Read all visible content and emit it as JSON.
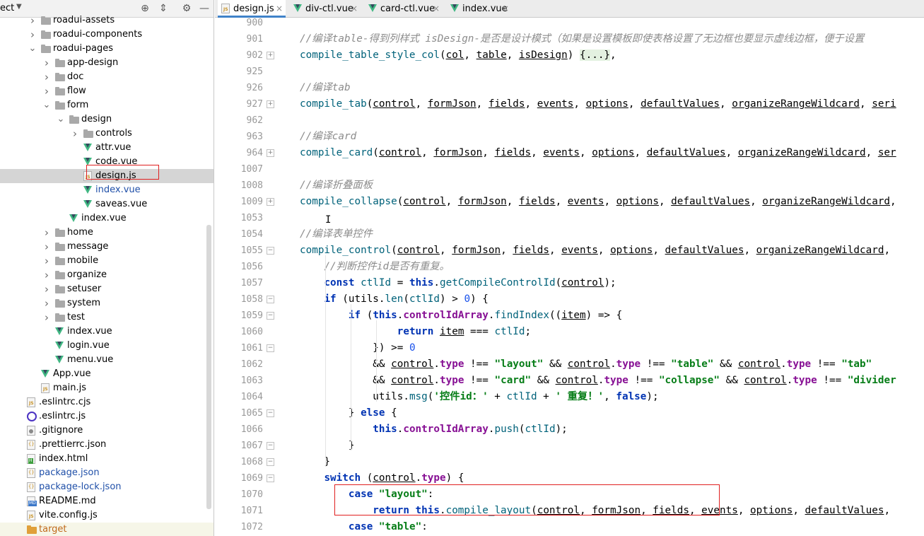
{
  "project_panel": {
    "title": "ect",
    "tree": [
      {
        "label": "roadui-assets",
        "kind": "folder",
        "depth": 1,
        "expanded": false
      },
      {
        "label": "roadui-components",
        "kind": "folder",
        "depth": 1,
        "expanded": false
      },
      {
        "label": "roadui-pages",
        "kind": "folder",
        "depth": 1,
        "expanded": true
      },
      {
        "label": "app-design",
        "kind": "folder",
        "depth": 2,
        "expanded": false
      },
      {
        "label": "doc",
        "kind": "folder",
        "depth": 2,
        "expanded": false
      },
      {
        "label": "flow",
        "kind": "folder",
        "depth": 2,
        "expanded": false
      },
      {
        "label": "form",
        "kind": "folder",
        "depth": 2,
        "expanded": true
      },
      {
        "label": "design",
        "kind": "folder",
        "depth": 3,
        "expanded": true
      },
      {
        "label": "controls",
        "kind": "folder",
        "depth": 4,
        "expanded": false
      },
      {
        "label": "attr.vue",
        "kind": "vue",
        "depth": 4
      },
      {
        "label": "code.vue",
        "kind": "vue",
        "depth": 4
      },
      {
        "label": "design.js",
        "kind": "js",
        "depth": 4,
        "selected": true
      },
      {
        "label": "index.vue",
        "kind": "vue",
        "depth": 4,
        "blue": true
      },
      {
        "label": "saveas.vue",
        "kind": "vue",
        "depth": 4
      },
      {
        "label": "index.vue",
        "kind": "vue",
        "depth": 3
      },
      {
        "label": "home",
        "kind": "folder",
        "depth": 2,
        "expanded": false
      },
      {
        "label": "message",
        "kind": "folder",
        "depth": 2,
        "expanded": false
      },
      {
        "label": "mobile",
        "kind": "folder",
        "depth": 2,
        "expanded": false
      },
      {
        "label": "organize",
        "kind": "folder",
        "depth": 2,
        "expanded": false
      },
      {
        "label": "setuser",
        "kind": "folder",
        "depth": 2,
        "expanded": false
      },
      {
        "label": "system",
        "kind": "folder",
        "depth": 2,
        "expanded": false
      },
      {
        "label": "test",
        "kind": "folder",
        "depth": 2,
        "expanded": false
      },
      {
        "label": "index.vue",
        "kind": "vue",
        "depth": 2
      },
      {
        "label": "login.vue",
        "kind": "vue",
        "depth": 2
      },
      {
        "label": "menu.vue",
        "kind": "vue",
        "depth": 2
      },
      {
        "label": "App.vue",
        "kind": "vue",
        "depth": 1
      },
      {
        "label": "main.js",
        "kind": "js",
        "depth": 1
      },
      {
        "label": ".eslintrc.cjs",
        "kind": "js",
        "depth": 0
      },
      {
        "label": ".eslintrc.js",
        "kind": "eslint",
        "depth": 0
      },
      {
        "label": ".gitignore",
        "kind": "git",
        "depth": 0
      },
      {
        "label": ".prettierrc.json",
        "kind": "json",
        "depth": 0
      },
      {
        "label": "index.html",
        "kind": "html",
        "depth": 0
      },
      {
        "label": "package.json",
        "kind": "json",
        "depth": 0,
        "blue": true
      },
      {
        "label": "package-lock.json",
        "kind": "json",
        "depth": 0,
        "blue": true
      },
      {
        "label": "README.md",
        "kind": "md",
        "depth": 0
      },
      {
        "label": "vite.config.js",
        "kind": "js",
        "depth": 0
      },
      {
        "label": "target",
        "kind": "folder-orange",
        "depth": 0,
        "orange": true
      }
    ]
  },
  "tabs": [
    {
      "label": "design.js",
      "kind": "js",
      "active": true
    },
    {
      "label": "div-ctl.vue",
      "kind": "vue"
    },
    {
      "label": "card-ctl.vue",
      "kind": "vue"
    },
    {
      "label": "index.vue",
      "kind": "vue"
    }
  ],
  "tab_close_glyph": "×",
  "line_numbers": [
    "900",
    "901",
    "902",
    "925",
    "926",
    "927",
    "962",
    "963",
    "964",
    "1007",
    "1008",
    "1009",
    "1053",
    "1054",
    "1055",
    "1056",
    "1057",
    "1058",
    "1059",
    "1060",
    "1061",
    "1062",
    "1063",
    "1064",
    "1065",
    "1066",
    "1067",
    "1068",
    "1069",
    "1070",
    "1071",
    "1072"
  ],
  "code_lines": [
    [],
    [
      [
        "cm",
        "//编译table-得到列样式 isDesign-是否是设计模式（如果是设置模板即使表格设置了无边框也要显示虚线边框，便于设置"
      ]
    ],
    [
      [
        "fn",
        "compile_table_style_col"
      ],
      [
        "t",
        "("
      ],
      [
        "prm",
        "col"
      ],
      [
        "t",
        ", "
      ],
      [
        "prm",
        "table"
      ],
      [
        "t",
        ", "
      ],
      [
        "prm",
        "isDesign"
      ],
      [
        "t",
        ") "
      ],
      [
        "fld",
        "{...}"
      ],
      [
        "t",
        ","
      ]
    ],
    [],
    [
      [
        "cm",
        "//编译tab"
      ]
    ],
    [
      [
        "fn",
        "compile_tab"
      ],
      [
        "t",
        "("
      ],
      [
        "prm",
        "control"
      ],
      [
        "t",
        ", "
      ],
      [
        "prm",
        "formJson"
      ],
      [
        "t",
        ", "
      ],
      [
        "prm",
        "fields"
      ],
      [
        "t",
        ", "
      ],
      [
        "prm",
        "events"
      ],
      [
        "t",
        ", "
      ],
      [
        "prm",
        "options"
      ],
      [
        "t",
        ", "
      ],
      [
        "prm",
        "defaultValues"
      ],
      [
        "t",
        ", "
      ],
      [
        "prm",
        "organizeRangeWildcard"
      ],
      [
        "t",
        ", "
      ],
      [
        "prm",
        "seri"
      ]
    ],
    [],
    [
      [
        "cm",
        "//编译card"
      ]
    ],
    [
      [
        "fn",
        "compile_card"
      ],
      [
        "t",
        "("
      ],
      [
        "prm",
        "control"
      ],
      [
        "t",
        ", "
      ],
      [
        "prm",
        "formJson"
      ],
      [
        "t",
        ", "
      ],
      [
        "prm",
        "fields"
      ],
      [
        "t",
        ", "
      ],
      [
        "prm",
        "events"
      ],
      [
        "t",
        ", "
      ],
      [
        "prm",
        "options"
      ],
      [
        "t",
        ", "
      ],
      [
        "prm",
        "defaultValues"
      ],
      [
        "t",
        ", "
      ],
      [
        "prm",
        "organizeRangeWildcard"
      ],
      [
        "t",
        ", "
      ],
      [
        "prm",
        "ser"
      ]
    ],
    [],
    [
      [
        "cm",
        "//编译折叠面板"
      ]
    ],
    [
      [
        "fn",
        "compile_collapse"
      ],
      [
        "t",
        "("
      ],
      [
        "prm",
        "control"
      ],
      [
        "t",
        ", "
      ],
      [
        "prm",
        "formJson"
      ],
      [
        "t",
        ", "
      ],
      [
        "prm",
        "fields"
      ],
      [
        "t",
        ", "
      ],
      [
        "prm",
        "events"
      ],
      [
        "t",
        ", "
      ],
      [
        "prm",
        "options"
      ],
      [
        "t",
        ", "
      ],
      [
        "prm",
        "defaultValues"
      ],
      [
        "t",
        ", "
      ],
      [
        "prm",
        "organizeRangeWildcard"
      ],
      [
        "t",
        ","
      ]
    ],
    [],
    [
      [
        "cm",
        "//编译表单控件"
      ]
    ],
    [
      [
        "fn",
        "compile_control"
      ],
      [
        "t",
        "("
      ],
      [
        "prm",
        "control"
      ],
      [
        "t",
        ", "
      ],
      [
        "prm",
        "formJson"
      ],
      [
        "t",
        ", "
      ],
      [
        "prm",
        "fields"
      ],
      [
        "t",
        ", "
      ],
      [
        "prm",
        "events"
      ],
      [
        "t",
        ", "
      ],
      [
        "prm",
        "options"
      ],
      [
        "t",
        ", "
      ],
      [
        "prm",
        "defaultValues"
      ],
      [
        "t",
        ", "
      ],
      [
        "prm",
        "organizeRangeWildcard"
      ],
      [
        "t",
        ", "
      ]
    ],
    [
      [
        "t",
        "    "
      ],
      [
        "cm",
        "//判断控件id是否有重复。"
      ]
    ],
    [
      [
        "t",
        "    "
      ],
      [
        "kw",
        "const "
      ],
      [
        "var",
        "ctlId"
      ],
      [
        "t",
        " = "
      ],
      [
        "kw",
        "this"
      ],
      [
        "t",
        "."
      ],
      [
        "mth",
        "getCompileControlId"
      ],
      [
        "t",
        "("
      ],
      [
        "prm",
        "control"
      ],
      [
        "t",
        ");"
      ]
    ],
    [
      [
        "t",
        "    "
      ],
      [
        "kw",
        "if "
      ],
      [
        "t",
        "(utils."
      ],
      [
        "mth",
        "len"
      ],
      [
        "t",
        "("
      ],
      [
        "var",
        "ctlId"
      ],
      [
        "t",
        ") > "
      ],
      [
        "num",
        "0"
      ],
      [
        "t",
        ") {"
      ]
    ],
    [
      [
        "t",
        "        "
      ],
      [
        "kw",
        "if "
      ],
      [
        "t",
        "("
      ],
      [
        "kw",
        "this"
      ],
      [
        "t",
        "."
      ],
      [
        "prop",
        "controlIdArray"
      ],
      [
        "t",
        "."
      ],
      [
        "mth",
        "findIndex"
      ],
      [
        "t",
        "(("
      ],
      [
        "prm",
        "item"
      ],
      [
        "t",
        ") => {"
      ]
    ],
    [
      [
        "t",
        "                "
      ],
      [
        "kw",
        "return "
      ],
      [
        "prm",
        "item"
      ],
      [
        "t",
        " === "
      ],
      [
        "var",
        "ctlId"
      ],
      [
        "t",
        ";"
      ]
    ],
    [
      [
        "t",
        "            }) >= "
      ],
      [
        "num",
        "0"
      ]
    ],
    [
      [
        "t",
        "            && "
      ],
      [
        "prm",
        "control"
      ],
      [
        "t",
        "."
      ],
      [
        "prop",
        "type"
      ],
      [
        "t",
        " !== "
      ],
      [
        "str",
        "\"layout\""
      ],
      [
        "t",
        " && "
      ],
      [
        "prm",
        "control"
      ],
      [
        "t",
        "."
      ],
      [
        "prop",
        "type"
      ],
      [
        "t",
        " !== "
      ],
      [
        "str",
        "\"table\""
      ],
      [
        "t",
        " && "
      ],
      [
        "prm",
        "control"
      ],
      [
        "t",
        "."
      ],
      [
        "prop",
        "type"
      ],
      [
        "t",
        " !== "
      ],
      [
        "str",
        "\"tab\""
      ]
    ],
    [
      [
        "t",
        "            && "
      ],
      [
        "prm",
        "control"
      ],
      [
        "t",
        "."
      ],
      [
        "prop",
        "type"
      ],
      [
        "t",
        " !== "
      ],
      [
        "str",
        "\"card\""
      ],
      [
        "t",
        " && "
      ],
      [
        "prm",
        "control"
      ],
      [
        "t",
        "."
      ],
      [
        "prop",
        "type"
      ],
      [
        "t",
        " !== "
      ],
      [
        "str",
        "\"collapse\""
      ],
      [
        "t",
        " && "
      ],
      [
        "prm",
        "control"
      ],
      [
        "t",
        "."
      ],
      [
        "prop",
        "type"
      ],
      [
        "t",
        " !== "
      ],
      [
        "str",
        "\"divider"
      ]
    ],
    [
      [
        "t",
        "            utils."
      ],
      [
        "mth",
        "msg"
      ],
      [
        "t",
        "("
      ],
      [
        "str",
        "'控件id：'"
      ],
      [
        "t",
        " + "
      ],
      [
        "var",
        "ctlId"
      ],
      [
        "t",
        " + "
      ],
      [
        "str",
        "' 重复！'"
      ],
      [
        "t",
        ", "
      ],
      [
        "kw",
        "false"
      ],
      [
        "t",
        ");"
      ]
    ],
    [
      [
        "t",
        "        } "
      ],
      [
        "kw",
        "else "
      ],
      [
        "t",
        "{"
      ]
    ],
    [
      [
        "t",
        "            "
      ],
      [
        "kw",
        "this"
      ],
      [
        "t",
        "."
      ],
      [
        "prop",
        "controlIdArray"
      ],
      [
        "t",
        "."
      ],
      [
        "mth",
        "push"
      ],
      [
        "t",
        "("
      ],
      [
        "var",
        "ctlId"
      ],
      [
        "t",
        ");"
      ]
    ],
    [
      [
        "t",
        "        }"
      ]
    ],
    [
      [
        "t",
        "    }"
      ]
    ],
    [
      [
        "t",
        "    "
      ],
      [
        "kw",
        "switch "
      ],
      [
        "t",
        "("
      ],
      [
        "prm",
        "control"
      ],
      [
        "t",
        "."
      ],
      [
        "prop",
        "type"
      ],
      [
        "t",
        ") {"
      ]
    ],
    [
      [
        "t",
        "        "
      ],
      [
        "kw",
        "case "
      ],
      [
        "str",
        "\"layout\""
      ],
      [
        "t",
        ":"
      ]
    ],
    [
      [
        "t",
        "            "
      ],
      [
        "kw",
        "return this"
      ],
      [
        "t",
        "."
      ],
      [
        "mth",
        "compile_layout"
      ],
      [
        "t",
        "("
      ],
      [
        "prm",
        "control"
      ],
      [
        "t",
        ", "
      ],
      [
        "prm",
        "formJson"
      ],
      [
        "t",
        ", "
      ],
      [
        "prm",
        "fields"
      ],
      [
        "t",
        ", "
      ],
      [
        "prm",
        "events"
      ],
      [
        "t",
        ", "
      ],
      [
        "prm",
        "options"
      ],
      [
        "t",
        ", "
      ],
      [
        "prm",
        "defaultValues"
      ],
      [
        "t",
        ", "
      ]
    ],
    [
      [
        "t",
        "        "
      ],
      [
        "kw",
        "case "
      ],
      [
        "str",
        "\"table\""
      ],
      [
        "t",
        ":"
      ]
    ]
  ],
  "colors": {
    "comment": "#8c8c8c",
    "function": "#00627a",
    "keyword": "#0033b3",
    "string": "#067d17",
    "number": "#1750eb",
    "property": "#871094",
    "highlight_box": "#e02020",
    "active_tab_underline": "#4083c9"
  }
}
